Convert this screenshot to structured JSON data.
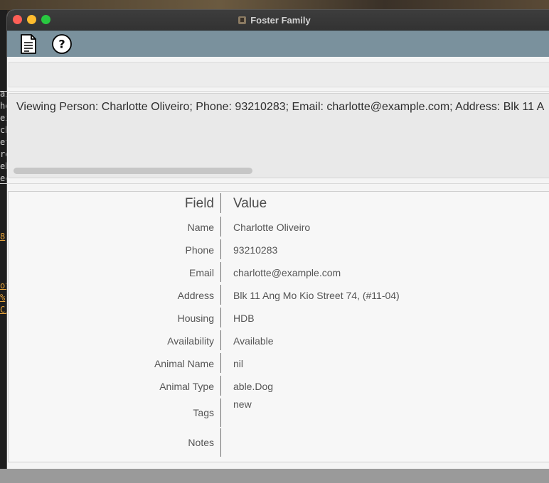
{
  "window": {
    "title": "Foster Family"
  },
  "toolbar": {
    "icons": [
      "document-icon",
      "help-icon"
    ]
  },
  "command": {
    "value": "",
    "placeholder": ""
  },
  "result": {
    "text": "Viewing Person: Charlotte Oliveiro; Phone: 93210283; Email: charlotte@example.com; Address: Blk 11 A"
  },
  "details": {
    "header": {
      "field": "Field",
      "value": "Value"
    },
    "rows": [
      {
        "field": "Name",
        "value": "Charlotte Oliveiro"
      },
      {
        "field": "Phone",
        "value": "93210283"
      },
      {
        "field": "Email",
        "value": "charlotte@example.com"
      },
      {
        "field": "Address",
        "value": "Blk 11 Ang Mo Kio Street 74, (#11-04)"
      },
      {
        "field": "Housing",
        "value": "HDB"
      },
      {
        "field": "Availability",
        "value": "Available"
      },
      {
        "field": "Animal Name",
        "value": "nil"
      },
      {
        "field": "Animal Type",
        "value": "able.Dog"
      },
      {
        "field": "Tags",
        "value": "new"
      },
      {
        "field": "Notes",
        "value": ""
      }
    ]
  },
  "desktop_fragments": [
    "ai",
    "he",
    "ei",
    "ch",
    "ef",
    "re",
    "eb",
    "ec",
    "8",
    "ot",
    "%",
    "C/"
  ],
  "colors": {
    "toolbar": "#7a919d",
    "titlebar": "#333333",
    "close": "#fe5f57",
    "minimize": "#febc2e",
    "maximize": "#28c840"
  }
}
